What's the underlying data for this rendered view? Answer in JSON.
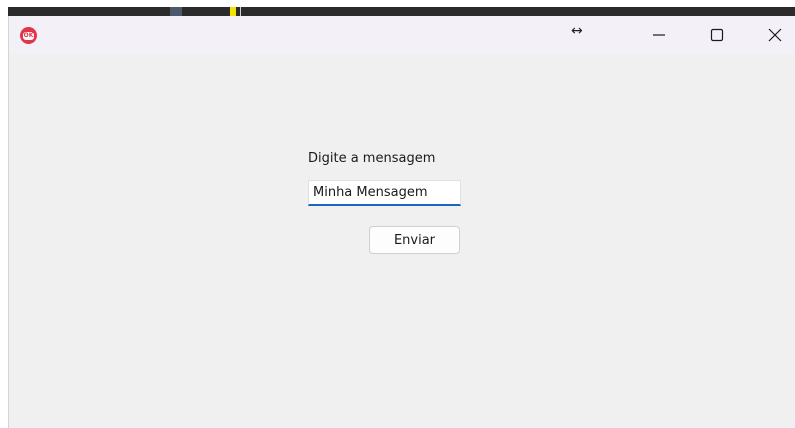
{
  "window": {
    "app_icon_text": "OK",
    "resize_glyph": "↔"
  },
  "form": {
    "prompt_label": "Digite a mensagem",
    "message_value": "Minha Mensagem",
    "send_label": "Enviar"
  },
  "colors": {
    "input_focus": "#1a66c0",
    "app_icon": "#e0354a"
  }
}
